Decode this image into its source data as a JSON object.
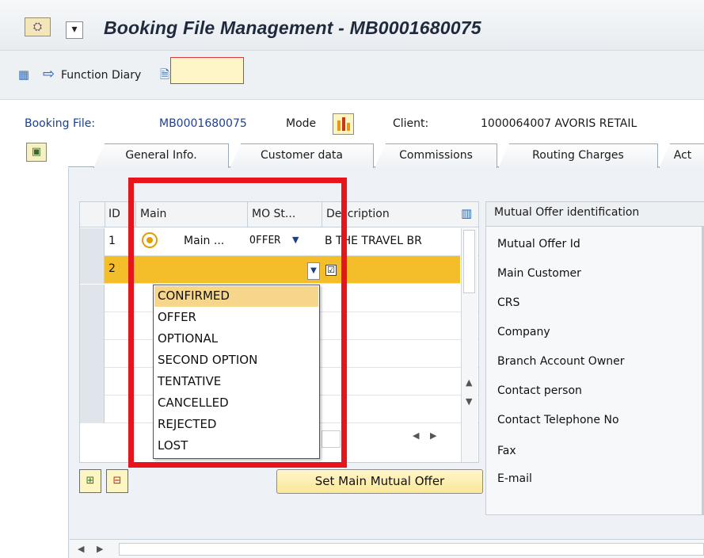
{
  "window": {
    "title": "Booking File Management - MB0001680075"
  },
  "toolbar": {
    "function_diary_label": "Function Diary"
  },
  "header": {
    "booking_file_label": "Booking File:",
    "booking_file_value": "MB0001680075",
    "mode_label": "Mode",
    "client_label": "Client:",
    "client_value": "1000064007  AVORIS RETAIL"
  },
  "tabs": [
    {
      "label": "General Info."
    },
    {
      "label": "Customer data"
    },
    {
      "label": "Commissions"
    },
    {
      "label": "Routing Charges"
    },
    {
      "label": "Act"
    }
  ],
  "table": {
    "columns": [
      "ID",
      "Main",
      "MO St...",
      "Description"
    ],
    "rows": [
      {
        "id": "1",
        "main": "Main ...",
        "status": "OFFER",
        "description": "B THE TRAVEL BR"
      },
      {
        "id": "2",
        "main": "",
        "status": "",
        "description": ""
      }
    ]
  },
  "dropdown": {
    "options": [
      "CONFIRMED",
      "OFFER",
      "OPTIONAL",
      "SECOND OPTION",
      "TENTATIVE",
      "CANCELLED",
      "REJECTED",
      "LOST"
    ],
    "selected": "CONFIRMED"
  },
  "mutual_offer": {
    "header": "Mutual Offer identification",
    "fields": [
      "Mutual Offer Id",
      "Main Customer",
      "CRS",
      "Company",
      "Branch Account Owner",
      "Contact person",
      "Contact Telephone No",
      "Fax",
      "E-mail"
    ]
  },
  "buttons": {
    "set_main_mutual_offer": "Set Main Mutual Offer"
  },
  "colors": {
    "highlight_box": "#e8141c",
    "selected_row": "#f4bd2a",
    "selected_option": "#f5d68a"
  }
}
